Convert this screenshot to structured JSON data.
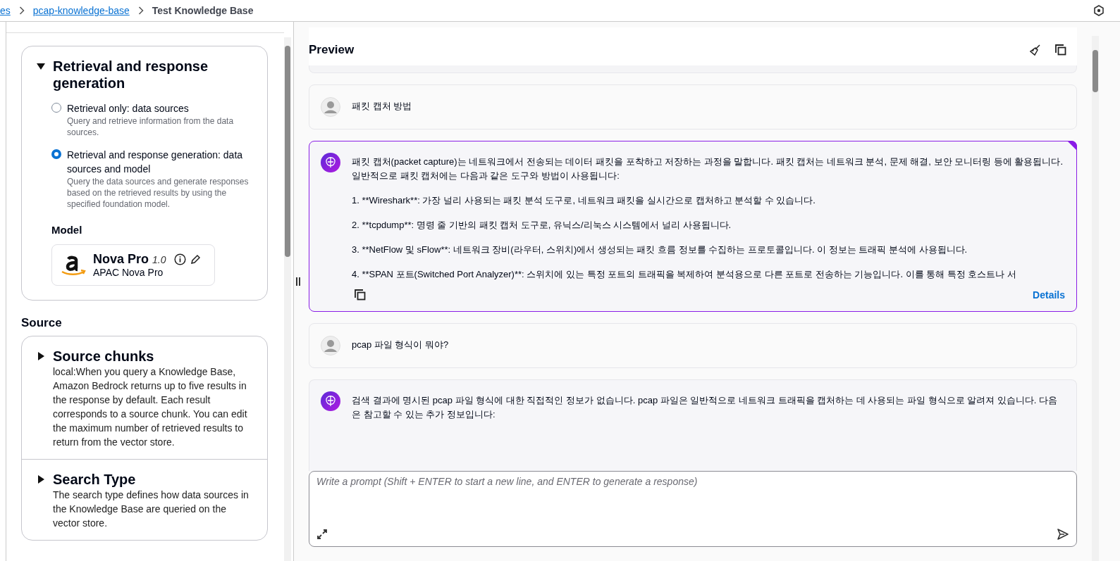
{
  "breadcrumb": [
    {
      "label": "es",
      "link": true
    },
    {
      "label": "pcap-knowledge-base",
      "link": true
    },
    {
      "label": "Test Knowledge Base",
      "link": false
    }
  ],
  "config": {
    "title": "Retrieval and response generation",
    "expanded": true,
    "options": [
      {
        "label": "Retrieval only: data sources",
        "description": "Query and retrieve information from the data sources.",
        "selected": false
      },
      {
        "label": "Retrieval and response generation: data sources and model",
        "description": "Query the data sources and generate responses based on the retrieved results by using the specified foundation model.",
        "selected": true
      }
    ],
    "model_heading": "Model",
    "model": {
      "name": "Nova Pro",
      "version": "1.0",
      "subtitle": "APAC Nova Pro"
    }
  },
  "source": {
    "heading": "Source",
    "sections": [
      {
        "title": "Source chunks",
        "expanded": false,
        "description": "local:When you query a Knowledge Base, Amazon Bedrock returns up to five results in the response by default. Each result corresponds to a source chunk. You can edit the maximum number of retrieved results to return from the vector store."
      },
      {
        "title": "Search Type",
        "expanded": false,
        "description": "The search type defines how data sources in the Knowledge Base are queried on the vector store."
      }
    ]
  },
  "preview": {
    "title": "Preview",
    "messages": [
      {
        "kind": "user",
        "selected": false,
        "paragraphs": [
          "패킷 캡처 방법"
        ]
      },
      {
        "kind": "assistant",
        "selected": true,
        "paragraphs": [
          "패킷 캡처(packet capture)는 네트워크에서 전송되는 데이터 패킷을 포착하고 저장하는 과정을 말합니다. 패킷 캡처는 네트워크 분석, 문제 해결, 보안 모니터링 등에 활용됩니다. 일반적으로 패킷 캡처에는 다음과 같은 도구와 방법이 사용됩니다:",
          "1. **Wireshark**: 가장 널리 사용되는 패킷 분석 도구로, 네트워크 패킷을 실시간으로 캡처하고 분석할 수 있습니다.",
          "2. **tcpdump**: 명령 줄 기반의 패킷 캡처 도구로, 유닉스/리눅스 시스템에서 널리 사용됩니다.",
          "3. **NetFlow 및 sFlow**: 네트워크 장비(라우터, 스위치)에서 생성되는 패킷 흐름 정보를 수집하는 프로토콜입니다. 이 정보는 트래픽 분석에 사용됩니다.",
          "4. **SPAN 포트(Switched Port Analyzer)**: 스위치에 있는 특정 포트의 트래픽을 복제하여 분석용으로 다른 포트로 전송하는 기능입니다. 이를 통해 특정 호스트나 서"
        ],
        "details": "Details"
      },
      {
        "kind": "user",
        "selected": false,
        "paragraphs": [
          "pcap 파일 형식이 뭐야?"
        ]
      },
      {
        "kind": "assistant",
        "selected": false,
        "paragraphs": [
          "검색 결과에 명시된 pcap 파일 형식에 대한 직접적인 정보가 없습니다. pcap 파일은 일반적으로 네트워크 트래픽을 캡처하는 데 사용되는 파일 형식으로 알려져 있습니다. 다음은 참고할 수 있는 추가 정보입니다:"
        ]
      }
    ],
    "prompt": {
      "placeholder": "Write a prompt (Shift + ENTER to start a new line, and ENTER to generate a response)"
    }
  }
}
